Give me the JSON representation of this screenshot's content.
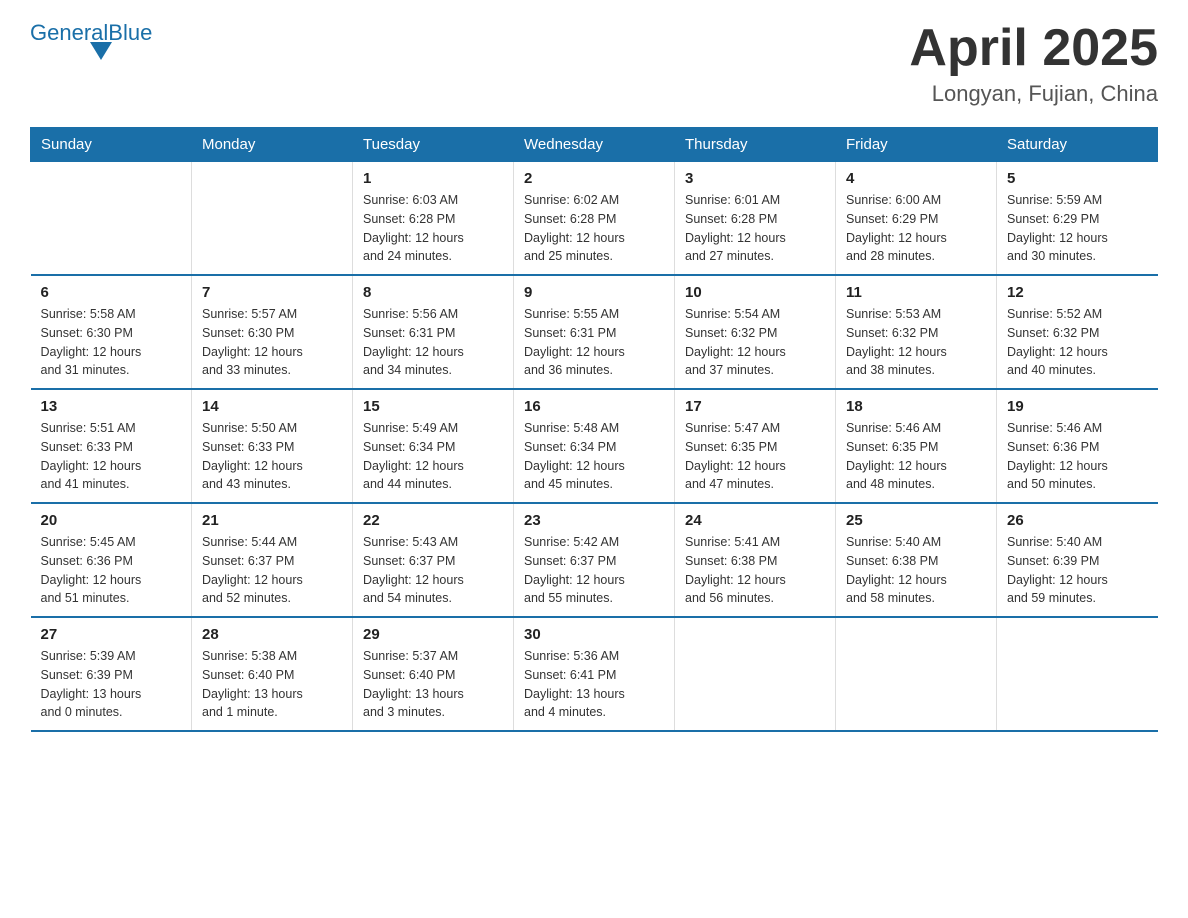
{
  "header": {
    "logo_text_general": "General",
    "logo_text_blue": "Blue",
    "title": "April 2025",
    "subtitle": "Longyan, Fujian, China"
  },
  "days_of_week": [
    "Sunday",
    "Monday",
    "Tuesday",
    "Wednesday",
    "Thursday",
    "Friday",
    "Saturday"
  ],
  "weeks": [
    [
      {
        "day": "",
        "info": ""
      },
      {
        "day": "",
        "info": ""
      },
      {
        "day": "1",
        "info": "Sunrise: 6:03 AM\nSunset: 6:28 PM\nDaylight: 12 hours\nand 24 minutes."
      },
      {
        "day": "2",
        "info": "Sunrise: 6:02 AM\nSunset: 6:28 PM\nDaylight: 12 hours\nand 25 minutes."
      },
      {
        "day": "3",
        "info": "Sunrise: 6:01 AM\nSunset: 6:28 PM\nDaylight: 12 hours\nand 27 minutes."
      },
      {
        "day": "4",
        "info": "Sunrise: 6:00 AM\nSunset: 6:29 PM\nDaylight: 12 hours\nand 28 minutes."
      },
      {
        "day": "5",
        "info": "Sunrise: 5:59 AM\nSunset: 6:29 PM\nDaylight: 12 hours\nand 30 minutes."
      }
    ],
    [
      {
        "day": "6",
        "info": "Sunrise: 5:58 AM\nSunset: 6:30 PM\nDaylight: 12 hours\nand 31 minutes."
      },
      {
        "day": "7",
        "info": "Sunrise: 5:57 AM\nSunset: 6:30 PM\nDaylight: 12 hours\nand 33 minutes."
      },
      {
        "day": "8",
        "info": "Sunrise: 5:56 AM\nSunset: 6:31 PM\nDaylight: 12 hours\nand 34 minutes."
      },
      {
        "day": "9",
        "info": "Sunrise: 5:55 AM\nSunset: 6:31 PM\nDaylight: 12 hours\nand 36 minutes."
      },
      {
        "day": "10",
        "info": "Sunrise: 5:54 AM\nSunset: 6:32 PM\nDaylight: 12 hours\nand 37 minutes."
      },
      {
        "day": "11",
        "info": "Sunrise: 5:53 AM\nSunset: 6:32 PM\nDaylight: 12 hours\nand 38 minutes."
      },
      {
        "day": "12",
        "info": "Sunrise: 5:52 AM\nSunset: 6:32 PM\nDaylight: 12 hours\nand 40 minutes."
      }
    ],
    [
      {
        "day": "13",
        "info": "Sunrise: 5:51 AM\nSunset: 6:33 PM\nDaylight: 12 hours\nand 41 minutes."
      },
      {
        "day": "14",
        "info": "Sunrise: 5:50 AM\nSunset: 6:33 PM\nDaylight: 12 hours\nand 43 minutes."
      },
      {
        "day": "15",
        "info": "Sunrise: 5:49 AM\nSunset: 6:34 PM\nDaylight: 12 hours\nand 44 minutes."
      },
      {
        "day": "16",
        "info": "Sunrise: 5:48 AM\nSunset: 6:34 PM\nDaylight: 12 hours\nand 45 minutes."
      },
      {
        "day": "17",
        "info": "Sunrise: 5:47 AM\nSunset: 6:35 PM\nDaylight: 12 hours\nand 47 minutes."
      },
      {
        "day": "18",
        "info": "Sunrise: 5:46 AM\nSunset: 6:35 PM\nDaylight: 12 hours\nand 48 minutes."
      },
      {
        "day": "19",
        "info": "Sunrise: 5:46 AM\nSunset: 6:36 PM\nDaylight: 12 hours\nand 50 minutes."
      }
    ],
    [
      {
        "day": "20",
        "info": "Sunrise: 5:45 AM\nSunset: 6:36 PM\nDaylight: 12 hours\nand 51 minutes."
      },
      {
        "day": "21",
        "info": "Sunrise: 5:44 AM\nSunset: 6:37 PM\nDaylight: 12 hours\nand 52 minutes."
      },
      {
        "day": "22",
        "info": "Sunrise: 5:43 AM\nSunset: 6:37 PM\nDaylight: 12 hours\nand 54 minutes."
      },
      {
        "day": "23",
        "info": "Sunrise: 5:42 AM\nSunset: 6:37 PM\nDaylight: 12 hours\nand 55 minutes."
      },
      {
        "day": "24",
        "info": "Sunrise: 5:41 AM\nSunset: 6:38 PM\nDaylight: 12 hours\nand 56 minutes."
      },
      {
        "day": "25",
        "info": "Sunrise: 5:40 AM\nSunset: 6:38 PM\nDaylight: 12 hours\nand 58 minutes."
      },
      {
        "day": "26",
        "info": "Sunrise: 5:40 AM\nSunset: 6:39 PM\nDaylight: 12 hours\nand 59 minutes."
      }
    ],
    [
      {
        "day": "27",
        "info": "Sunrise: 5:39 AM\nSunset: 6:39 PM\nDaylight: 13 hours\nand 0 minutes."
      },
      {
        "day": "28",
        "info": "Sunrise: 5:38 AM\nSunset: 6:40 PM\nDaylight: 13 hours\nand 1 minute."
      },
      {
        "day": "29",
        "info": "Sunrise: 5:37 AM\nSunset: 6:40 PM\nDaylight: 13 hours\nand 3 minutes."
      },
      {
        "day": "30",
        "info": "Sunrise: 5:36 AM\nSunset: 6:41 PM\nDaylight: 13 hours\nand 4 minutes."
      },
      {
        "day": "",
        "info": ""
      },
      {
        "day": "",
        "info": ""
      },
      {
        "day": "",
        "info": ""
      }
    ]
  ]
}
